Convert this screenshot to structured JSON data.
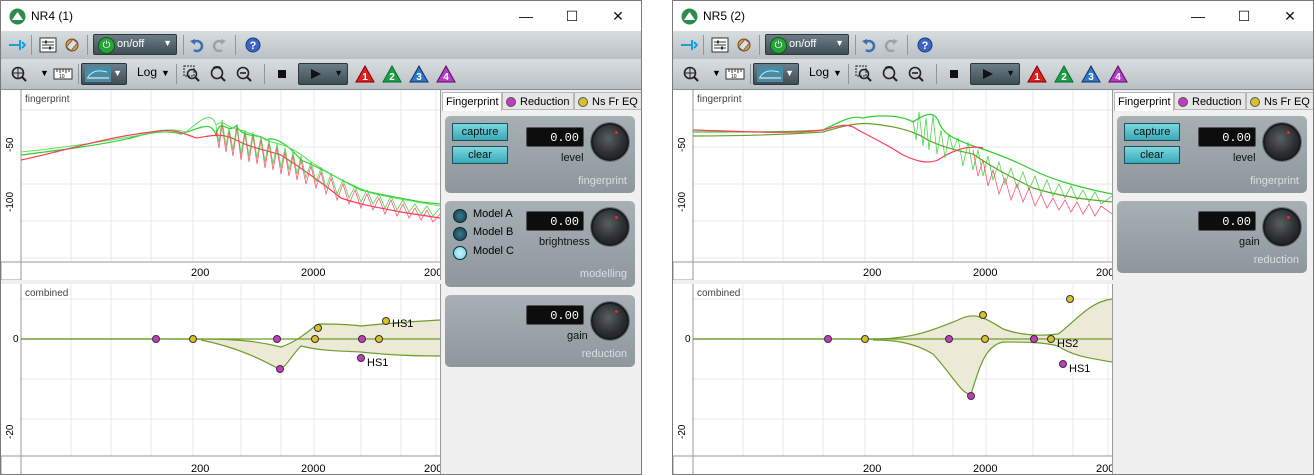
{
  "windows": [
    {
      "id": "left",
      "title": "NR4 (1)",
      "toolbar": {
        "onoff_label": "on/off",
        "scale_label": "Log"
      },
      "top_plot": {
        "label": "fingerprint",
        "ticks_x": [
          "200",
          "2000",
          "200"
        ],
        "ticks_y": [
          "-50",
          "-100"
        ]
      },
      "bottom_plot": {
        "label": "combined",
        "ticks_x": [
          "200",
          "2000",
          "200"
        ],
        "ticks_y": [
          "0",
          "-20"
        ],
        "annotations": [
          "HS1",
          "HS1"
        ]
      },
      "side": {
        "tabs": [
          "Fingerprint",
          "Reduction",
          "Ns Fr EQ"
        ],
        "fingerprint": {
          "capture": "capture",
          "clear": "clear",
          "value": "0.00",
          "knob_label": "level",
          "footer": "fingerprint"
        },
        "modelling": {
          "models": [
            "Model A",
            "Model B",
            "Model C"
          ],
          "value": "0.00",
          "knob_label": "brightness",
          "footer": "modelling"
        },
        "reduction": {
          "value": "0.00",
          "knob_label": "gain",
          "footer": "reduction"
        }
      }
    },
    {
      "id": "right",
      "title": "NR5 (2)",
      "toolbar": {
        "onoff_label": "on/off",
        "scale_label": "Log"
      },
      "top_plot": {
        "label": "fingerprint",
        "ticks_x": [
          "200",
          "2000",
          "200"
        ],
        "ticks_y": [
          "-50",
          "-100"
        ]
      },
      "bottom_plot": {
        "label": "combined",
        "ticks_x": [
          "200",
          "2000",
          "200"
        ],
        "ticks_y": [
          "0",
          "-20"
        ],
        "annotations": [
          "HS2",
          "HS1"
        ]
      },
      "side": {
        "tabs": [
          "Fingerprint",
          "Reduction",
          "Ns Fr EQ"
        ],
        "fingerprint": {
          "capture": "capture",
          "clear": "clear",
          "value": "0.00",
          "knob_label": "level",
          "footer": "fingerprint"
        },
        "reduction": {
          "value": "0.00",
          "knob_label": "gain",
          "footer": "reduction"
        }
      }
    }
  ],
  "colors": {
    "green": "#2fcf2f",
    "red": "#ff3a5a",
    "olive": "#6b9e2a",
    "magenta_dot": "#c23bc2",
    "yellow_dot": "#d8c22a"
  }
}
